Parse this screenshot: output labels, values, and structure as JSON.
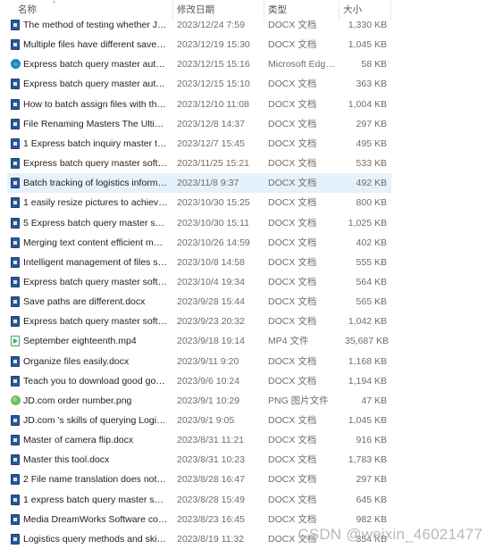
{
  "header": {
    "name": "名称",
    "modified": "修改日期",
    "type": "类型",
    "size": "大小"
  },
  "files": [
    {
      "name": "The method of testing whether JD.co...",
      "date": "2023/12/24 7:59",
      "type": "DOCX 文档",
      "size": "1,330 KB",
      "icon": "docx"
    },
    {
      "name": "Multiple files have different save pat...",
      "date": "2023/12/19 15:30",
      "type": "DOCX 文档",
      "size": "1,045 KB",
      "icon": "docx"
    },
    {
      "name": "Express batch query master automati...",
      "date": "2023/12/15 15:16",
      "type": "Microsoft Edge ...",
      "size": "58 KB",
      "icon": "edge"
    },
    {
      "name": "Express batch query master automati...",
      "date": "2023/12/15 15:10",
      "type": "DOCX 文档",
      "size": "363 KB",
      "icon": "docx"
    },
    {
      "name": "How to batch assign files with the sa...",
      "date": "2023/12/10 11:08",
      "type": "DOCX 文档",
      "size": "1,004 KB",
      "icon": "docx"
    },
    {
      "name": "File Renaming Masters The Ultimate ...",
      "date": "2023/12/8 14:37",
      "type": "DOCX 文档",
      "size": "297 KB",
      "icon": "docx"
    },
    {
      "name": "1 Express batch inquiry master the s...",
      "date": "2023/12/7 15:45",
      "type": "DOCX 文档",
      "size": "495 KB",
      "icon": "docx"
    },
    {
      "name": "Express batch query master software...",
      "date": "2023/11/25 15:21",
      "type": "DOCX 文档",
      "size": "533 KB",
      "icon": "docx"
    },
    {
      "name": "Batch tracking of logistics informatio...",
      "date": "2023/11/8 9:37",
      "type": "DOCX 文档",
      "size": "492 KB",
      "icon": "docx",
      "selected": true
    },
    {
      "name": "1 easily resize pictures to achieve effi...",
      "date": "2023/10/30 15:25",
      "type": "DOCX 文档",
      "size": "800 KB",
      "icon": "docx"
    },
    {
      "name": "5 Express batch query master softwa...",
      "date": "2023/10/30 15:11",
      "type": "DOCX 文档",
      "size": "1,025 KB",
      "icon": "docx"
    },
    {
      "name": "Merging text content efficient metho...",
      "date": "2023/10/26 14:59",
      "type": "DOCX 文档",
      "size": "402 KB",
      "icon": "docx"
    },
    {
      "name": "Intelligent management of files saves...",
      "date": "2023/10/8 14:58",
      "type": "DOCX 文档",
      "size": "555 KB",
      "icon": "docx"
    },
    {
      "name": "Express batch query master software...",
      "date": "2023/10/4 19:34",
      "type": "DOCX 文档",
      "size": "564 KB",
      "icon": "docx"
    },
    {
      "name": "Save paths are different.docx",
      "date": "2023/9/28 15:44",
      "type": "DOCX 文档",
      "size": "565 KB",
      "icon": "docx"
    },
    {
      "name": "Express batch query master software...",
      "date": "2023/9/23 20:32",
      "type": "DOCX 文档",
      "size": "1,042 KB",
      "icon": "docx"
    },
    {
      "name": "September eighteenth.mp4",
      "date": "2023/9/18 19:14",
      "type": "MP4 文件",
      "size": "35,687 KB",
      "icon": "mp4"
    },
    {
      "name": "Organize files easily.docx",
      "date": "2023/9/11 9:20",
      "type": "DOCX 文档",
      "size": "1,168 KB",
      "icon": "docx"
    },
    {
      "name": "Teach you to download good goods...",
      "date": "2023/9/6 10:24",
      "type": "DOCX 文档",
      "size": "1,194 KB",
      "icon": "docx"
    },
    {
      "name": "JD.com order number.png",
      "date": "2023/9/1 10:29",
      "type": "PNG 图片文件",
      "size": "47 KB",
      "icon": "png"
    },
    {
      "name": "JD.com 's skills of querying Logistics ...",
      "date": "2023/9/1 9:05",
      "type": "DOCX 文档",
      "size": "1,045 KB",
      "icon": "docx"
    },
    {
      "name": "Master of camera flip.docx",
      "date": "2023/8/31 11:21",
      "type": "DOCX 文档",
      "size": "916 KB",
      "icon": "docx"
    },
    {
      "name": "Master this tool.docx",
      "date": "2023/8/31 10:23",
      "type": "DOCX 文档",
      "size": "1,783 KB",
      "icon": "docx"
    },
    {
      "name": "2 File name translation does not ask ...",
      "date": "2023/8/28 16:47",
      "type": "DOCX 文档",
      "size": "297 KB",
      "icon": "docx"
    },
    {
      "name": "1 express batch query master sharin...",
      "date": "2023/8/28 15:49",
      "type": "DOCX 文档",
      "size": "645 KB",
      "icon": "docx"
    },
    {
      "name": "Media DreamWorks Software course...",
      "date": "2023/8/23 16:45",
      "type": "DOCX 文档",
      "size": "982 KB",
      "icon": "docx"
    },
    {
      "name": "Logistics query methods and skills of...",
      "date": "2023/8/19 11:32",
      "type": "DOCX 文档",
      "size": "354 KB",
      "icon": "docx"
    }
  ],
  "watermark": "CSDN @weixin_46021477"
}
